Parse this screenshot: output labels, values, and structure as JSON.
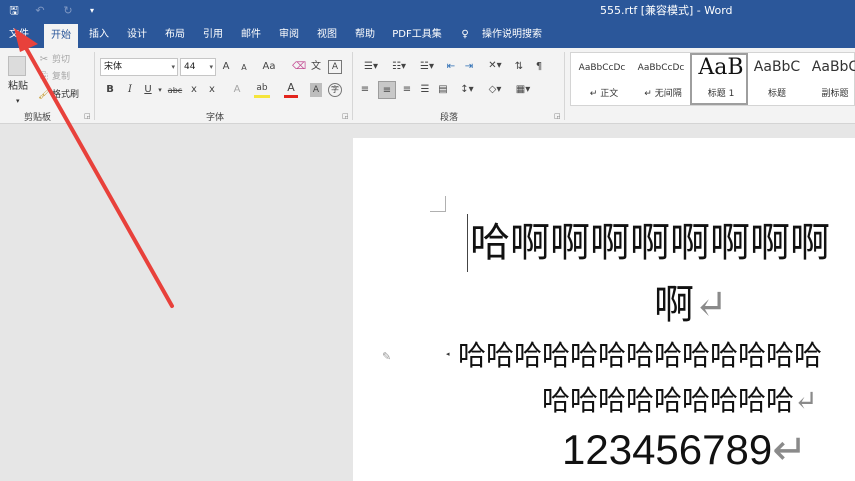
{
  "window": {
    "title": "555.rtf [兼容模式] - Word"
  },
  "quick_access": {
    "save_icon": "save-icon",
    "undo_icon": "undo-icon",
    "redo_icon": "redo-icon",
    "customize_icon": "customize-icon"
  },
  "tabs": [
    {
      "label": "文件",
      "active": false
    },
    {
      "label": "开始",
      "active": true
    },
    {
      "label": "插入",
      "active": false
    },
    {
      "label": "设计",
      "active": false
    },
    {
      "label": "布局",
      "active": false
    },
    {
      "label": "引用",
      "active": false
    },
    {
      "label": "邮件",
      "active": false
    },
    {
      "label": "审阅",
      "active": false
    },
    {
      "label": "视图",
      "active": false
    },
    {
      "label": "帮助",
      "active": false
    },
    {
      "label": "PDF工具集",
      "active": false
    }
  ],
  "tell_me": "操作说明搜索",
  "clipboard": {
    "paste": "粘贴",
    "cut": "剪切",
    "copy": "复制",
    "format_painter": "格式刷",
    "group_label": "剪贴板"
  },
  "font": {
    "font_name": "宋体",
    "font_size": "44",
    "grow": "A",
    "shrink": "A",
    "case": "Aa",
    "bold": "B",
    "italic": "I",
    "underline": "U",
    "strike": "abc",
    "subscript": "x",
    "superscript": "x",
    "text_color": "A",
    "highlight_color": "ab",
    "group_label": "字体"
  },
  "paragraph": {
    "group_label": "段落"
  },
  "styles": [
    {
      "preview": "AaBbCcDc",
      "name": "正文",
      "marker": "↵",
      "selected": false
    },
    {
      "preview": "AaBbCcDc",
      "name": "无间隔",
      "marker": "↵",
      "selected": false
    },
    {
      "preview": "AaB",
      "name": "标题 1",
      "marker": "",
      "selected": true
    },
    {
      "preview": "AaBbC",
      "name": "标题",
      "marker": "",
      "selected": false
    },
    {
      "preview": "AaBbC",
      "name": "副标题",
      "marker": "",
      "selected": false
    }
  ],
  "document": {
    "line1": "哈啊啊啊啊啊啊啊啊",
    "line2": "啊",
    "line3": "哈哈哈哈哈哈哈哈哈哈哈哈哈",
    "line4": "哈哈哈哈哈哈哈哈哈",
    "line5": "123456789",
    "paragraph_mark": "↵"
  },
  "colors": {
    "brand": "#2b579a",
    "arrow": "#e8413b",
    "font_color_bar": "#e3251d",
    "highlight_bar": "#f5e53c"
  }
}
